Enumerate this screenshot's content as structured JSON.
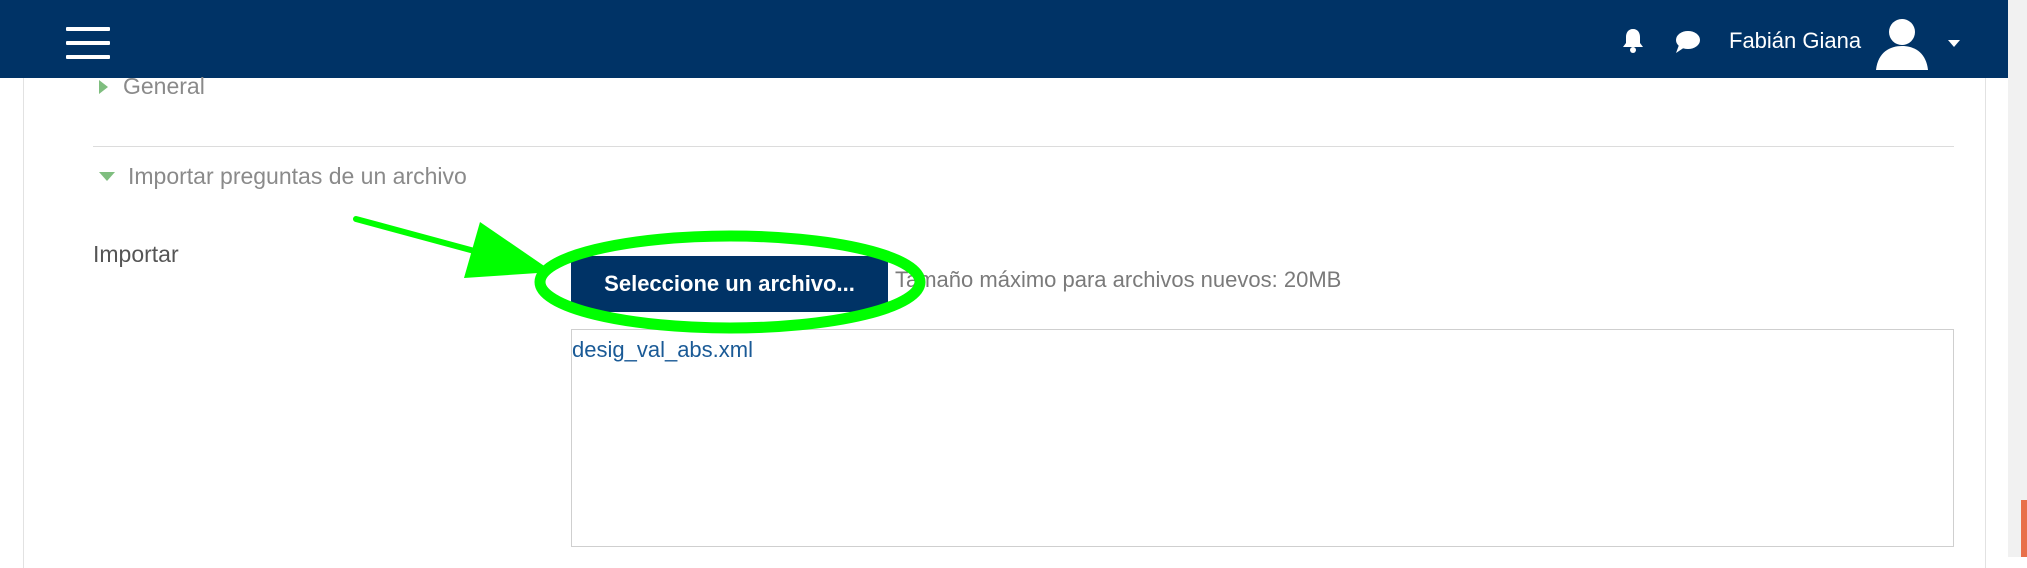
{
  "navbar": {
    "background": "#003366",
    "user_name": "Fabián Giana",
    "icons": [
      "menu-icon",
      "bell-icon",
      "chat-icon",
      "avatar-icon",
      "caret-down-icon"
    ]
  },
  "form": {
    "general_section": "General",
    "import_section": "Importar preguntas de un archivo",
    "import_label": "Importar",
    "choose_file_button": "Seleccione un archivo...",
    "max_size_text": "Tamaño máximo para archivos nuevos: 20MB",
    "selected_file": "desig_val_abs.xml"
  },
  "annotation": {
    "color": "#00ff00",
    "type": "arrow-and-ellipse"
  }
}
